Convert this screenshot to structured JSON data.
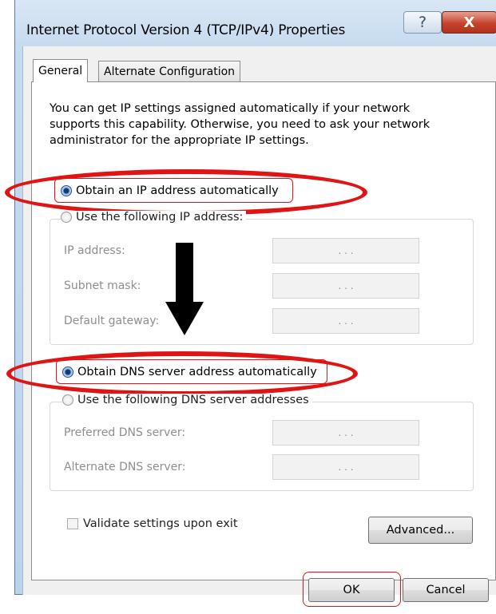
{
  "window": {
    "title": "Internet Protocol Version 4 (TCP/IPv4) Properties",
    "help_glyph": "?",
    "close_glyph": "X"
  },
  "tabs": [
    {
      "label": "General",
      "active": true
    },
    {
      "label": "Alternate Configuration",
      "active": false
    }
  ],
  "description": "You can get IP settings assigned automatically if your network supports this capability. Otherwise, you need to ask your network administrator for the appropriate IP settings.",
  "ip_section": {
    "auto_label": "Obtain an IP address automatically",
    "auto_selected": true,
    "manual_label": "Use the following IP address:",
    "fields": [
      {
        "label": "IP address:",
        "value": ". . ."
      },
      {
        "label": "Subnet mask:",
        "value": ". . ."
      },
      {
        "label": "Default gateway:",
        "value": ". . ."
      }
    ]
  },
  "dns_section": {
    "auto_label": "Obtain DNS server address automatically",
    "auto_selected": true,
    "manual_label": "Use the following DNS server addresses",
    "fields": [
      {
        "label": "Preferred DNS server:",
        "value": ". . ."
      },
      {
        "label": "Alternate DNS server:",
        "value": ". . ."
      }
    ]
  },
  "validate_label": "Validate settings upon exit",
  "validate_checked": false,
  "buttons": {
    "advanced": "Advanced...",
    "ok": "OK",
    "cancel": "Cancel"
  },
  "colors": {
    "annotation": "#e01414",
    "selected_radio": "#0d3c7a"
  }
}
